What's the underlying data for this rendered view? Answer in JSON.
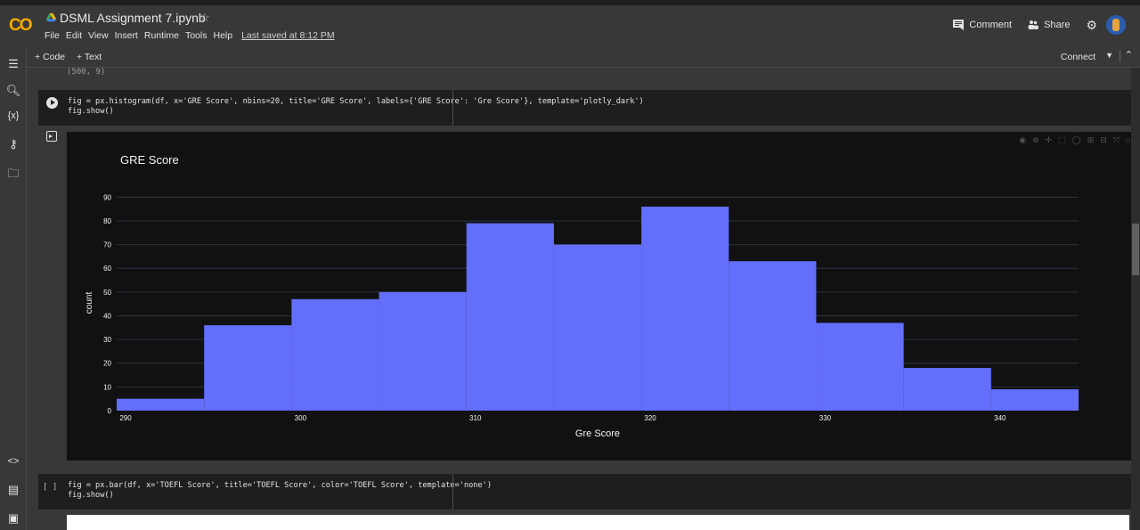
{
  "header": {
    "logo": "CO",
    "title": "DSML Assignment 7.ipynb",
    "star": "☆",
    "menu": [
      "File",
      "Edit",
      "View",
      "Insert",
      "Runtime",
      "Tools",
      "Help"
    ],
    "last_saved": "Last saved at 8:12 PM",
    "comment_label": "Comment",
    "share_label": "Share"
  },
  "toolbar": {
    "add_code": "+ Code",
    "add_text": "+ Text",
    "connect": "Connect"
  },
  "prev_output": "(500, 9)",
  "cell1": {
    "code_line1": "fig = px.histogram(df, x='GRE Score', nbins=20, title='GRE Score', labels={'GRE Score': 'Gre Score'}, template='plotly_dark')",
    "code_line2": "fig.show()"
  },
  "cell2": {
    "exec_count": "[ ]",
    "code_line1": "fig = px.bar(df, x='TOEFL Score', title='TOEFL Score', color='TOEFL Score', template='none')",
    "code_line2": "fig.show()"
  },
  "colors": {
    "bar": "#636efa",
    "plot_bg": "#111111"
  },
  "chart_data": {
    "type": "bar",
    "title": "GRE Score",
    "xlabel": "Gre Score",
    "ylabel": "count",
    "bin_edges": [
      290,
      295,
      300,
      305,
      310,
      315,
      320,
      325,
      330,
      335,
      340,
      345
    ],
    "values": [
      5,
      36,
      47,
      50,
      79,
      70,
      86,
      63,
      37,
      18,
      9
    ],
    "xlim": [
      290,
      345
    ],
    "ylim": [
      0,
      95
    ],
    "x_ticks": [
      290,
      300,
      310,
      320,
      330,
      340
    ],
    "y_ticks": [
      0,
      10,
      20,
      30,
      40,
      50,
      60,
      70,
      80,
      90
    ],
    "grid": true,
    "legend": "none"
  }
}
